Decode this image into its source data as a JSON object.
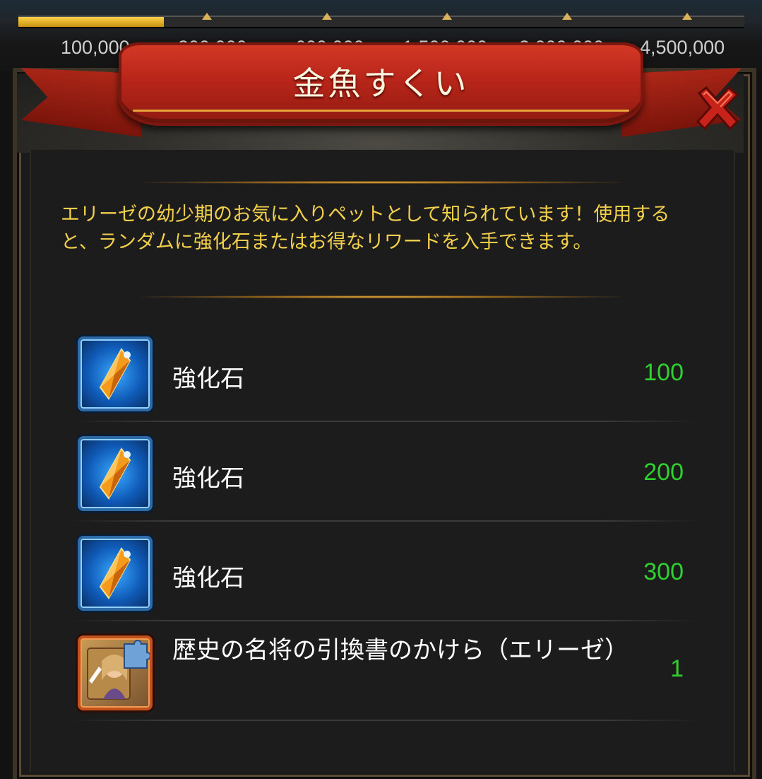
{
  "progress": {
    "fill_fraction": 0.2,
    "milestones": [
      "100,000",
      "300,000",
      "600,000",
      "1,500,000",
      "3,000,000",
      "4,500,000"
    ]
  },
  "dialog": {
    "title": "金魚すくい",
    "description": "エリーゼの幼少期のお気に入りペットとして知られています！使用すると、ランダムに強化石またはお得なリワードを入手できます。",
    "items": [
      {
        "name": "強化石",
        "quantity": "100",
        "icon": "enhancement-stone-icon"
      },
      {
        "name": "強化石",
        "quantity": "200",
        "icon": "enhancement-stone-icon"
      },
      {
        "name": "強化石",
        "quantity": "300",
        "icon": "enhancement-stone-icon"
      },
      {
        "name": "歴史の名将の引換書のかけら（エリーゼ）",
        "quantity": "1",
        "icon": "hero-voucher-fragment-icon"
      }
    ]
  },
  "colors": {
    "ribbon": "#b9251a",
    "description_text": "#f2d04b",
    "quantity_text": "#2fd02f",
    "item_text": "#ffffff"
  }
}
